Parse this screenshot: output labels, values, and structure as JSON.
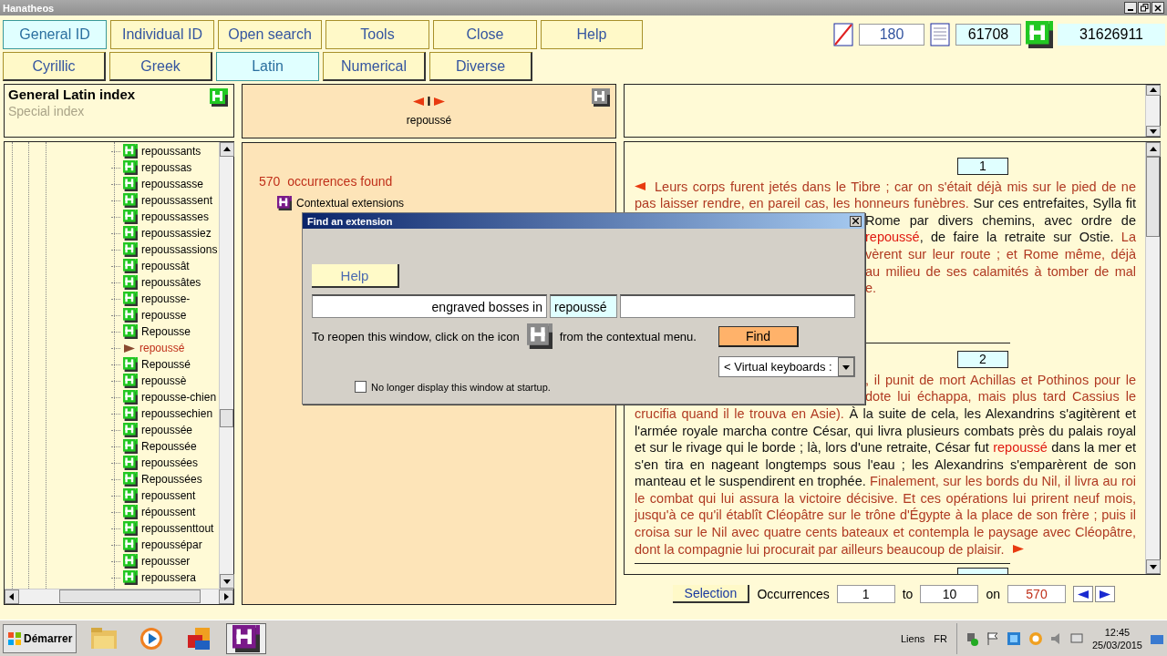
{
  "window": {
    "title": "Hanatheos"
  },
  "nav_buttons": [
    {
      "label": "General ID",
      "selected": true
    },
    {
      "label": "Individual ID",
      "selected": false
    },
    {
      "label": "Open search",
      "selected": false
    },
    {
      "label": "Tools",
      "selected": false
    },
    {
      "label": "Close",
      "selected": false
    },
    {
      "label": "Help",
      "selected": false
    }
  ],
  "alphabet_tabs": [
    {
      "label": "Cyrillic",
      "selected": false
    },
    {
      "label": "Greek",
      "selected": false
    },
    {
      "label": "Latin",
      "selected": true
    },
    {
      "label": "Numerical",
      "selected": false
    },
    {
      "label": "Diverse",
      "selected": false
    }
  ],
  "counters": [
    {
      "kind": "crossed-document",
      "value": "180"
    },
    {
      "kind": "pages",
      "value": "61708"
    },
    {
      "kind": "logo",
      "value": "31626911"
    }
  ],
  "index_panel": {
    "title": "General Latin index",
    "subtitle": "Special index",
    "subtitle_disabled": true
  },
  "index_list": [
    {
      "label": "repoussants",
      "selected": false
    },
    {
      "label": "repoussas",
      "selected": false
    },
    {
      "label": "repoussasse",
      "selected": false
    },
    {
      "label": "repoussassent",
      "selected": false
    },
    {
      "label": "repoussasses",
      "selected": false
    },
    {
      "label": "repoussassiez",
      "selected": false
    },
    {
      "label": "repoussassions",
      "selected": false
    },
    {
      "label": "repoussât",
      "selected": false
    },
    {
      "label": "repoussâtes",
      "selected": false
    },
    {
      "label": "repousse-",
      "selected": false
    },
    {
      "label": "repousse",
      "selected": false
    },
    {
      "label": "Repousse",
      "selected": false
    },
    {
      "label": "repoussé",
      "selected": true
    },
    {
      "label": "Repoussé",
      "selected": false
    },
    {
      "label": "repoussè",
      "selected": false
    },
    {
      "label": "repousse-chien",
      "selected": false
    },
    {
      "label": "repoussechien",
      "selected": false
    },
    {
      "label": "repoussée",
      "selected": false
    },
    {
      "label": "Repoussée",
      "selected": false
    },
    {
      "label": "repoussées",
      "selected": false
    },
    {
      "label": "Repoussées",
      "selected": false
    },
    {
      "label": "repoussent",
      "selected": false
    },
    {
      "label": "répoussent",
      "selected": false
    },
    {
      "label": "repoussenttout",
      "selected": false
    },
    {
      "label": "repoussépar",
      "selected": false
    },
    {
      "label": "repousser",
      "selected": false
    },
    {
      "label": "repoussera",
      "selected": false
    }
  ],
  "word_panel": {
    "separator": "I",
    "word": "repoussé"
  },
  "results": {
    "count": "570",
    "label": "occurrences found",
    "extension_label": "Contextual extensions"
  },
  "passages": [
    {
      "number": "1",
      "start_marker": true,
      "end_marker": false,
      "lines": [
        {
          "covered": false,
          "segments": [
            {
              "kind": "quote",
              "text": "Leurs corps furent jetés dans le Tibre ; car on s'était déjà mis sur le pied de ne"
            }
          ]
        },
        {
          "covered": false,
          "segments": [
            {
              "kind": "quote",
              "text": "pas laisser rendre, en pareil cas, les honneurs funèbres."
            },
            {
              "kind": "plain",
              "text": " Sur ces entrefaites, Sylla fit"
            }
          ]
        },
        {
          "covered": true,
          "segments": [
            {
              "kind": "plain",
              "text": "Rome par divers chemins, avec ordre de"
            }
          ]
        },
        {
          "covered": true,
          "segments": [
            {
              "kind": "match",
              "text": "repoussé"
            },
            {
              "kind": "plain",
              "text": ", de faire la retraite sur Ostie. "
            },
            {
              "kind": "quote",
              "text": "La"
            }
          ]
        },
        {
          "covered": true,
          "segments": [
            {
              "kind": "quote",
              "text": "vèrent sur leur route ; et Rome même, déjà"
            }
          ]
        },
        {
          "covered": true,
          "segments": [
            {
              "kind": "quote",
              "text": "au milieu de ses calamités à tomber de mal"
            }
          ]
        },
        {
          "covered": true,
          "segments": [
            {
              "kind": "quote",
              "text": "e."
            }
          ]
        }
      ]
    },
    {
      "number": "2",
      "start_marker": false,
      "end_marker": true,
      "lines": [
        {
          "covered": true,
          "segments": [
            {
              "kind": "quote",
              "text": ", il punit de mort Achillas et Pothinos pour le"
            }
          ]
        },
        {
          "covered": true,
          "segments": [
            {
              "kind": "quote",
              "text": "dote lui échappa, mais plus tard Cassius le"
            }
          ]
        },
        {
          "covered": false,
          "segments": [
            {
              "kind": "quote",
              "text": "crucifia quand il le trouva en Asie)."
            },
            {
              "kind": "plain",
              "text": " À la suite de cela, les Alexandrins s'agitèrent et"
            }
          ]
        },
        {
          "covered": false,
          "segments": [
            {
              "kind": "plain",
              "text": "l'armée royale marcha contre César, qui livra plusieurs combats près du palais royal"
            }
          ]
        },
        {
          "covered": false,
          "segments": [
            {
              "kind": "plain",
              "text": "et sur le rivage qui le borde ; là, lors d'une retraite, César fut "
            },
            {
              "kind": "match",
              "text": "repoussé"
            },
            {
              "kind": "plain",
              "text": " dans la mer et"
            }
          ]
        },
        {
          "covered": false,
          "segments": [
            {
              "kind": "plain",
              "text": "s'en tira en nageant longtemps sous l'eau ; les Alexandrins s'emparèrent de son"
            }
          ]
        },
        {
          "covered": false,
          "segments": [
            {
              "kind": "plain",
              "text": "manteau et le suspendirent en trophée. "
            },
            {
              "kind": "quote",
              "text": "Finalement, sur les bords du Nil, il livra au roi"
            }
          ]
        },
        {
          "covered": false,
          "segments": [
            {
              "kind": "quote",
              "text": "le combat qui lui assura la victoire décisive. Et ces opérations lui prirent neuf mois,"
            }
          ]
        },
        {
          "covered": false,
          "segments": [
            {
              "kind": "quote",
              "text": "jusqu'à ce qu'il établît Cléopâtre sur le trône d'Égypte à la place de son frère ; puis il"
            }
          ]
        },
        {
          "covered": false,
          "segments": [
            {
              "kind": "quote",
              "text": "croisa sur le Nil avec quatre cents bateaux et contempla le paysage avec Cléopâtre,"
            }
          ]
        },
        {
          "covered": false,
          "segments": [
            {
              "kind": "quote",
              "text": "dont la compagnie lui procurait par ailleurs beaucoup de plaisir."
            }
          ]
        }
      ]
    }
  ],
  "pagination": {
    "selection": "Selection",
    "occurrences_label": "Occurrences",
    "from": "1",
    "to_label": "to",
    "to": "10",
    "on_label": "on",
    "total": "570"
  },
  "dialog": {
    "title": "Find an extension",
    "help": "Help",
    "before": "engraved bosses in",
    "word": "repoussé",
    "hint_before": "To reopen this window, click on the icon",
    "hint_after": "from the contextual menu.",
    "find": "Find",
    "keyboards": "< Virtual keyboards :",
    "startup_label": "No longer display this window at startup.",
    "startup_checked": false
  },
  "taskbar": {
    "start": "Démarrer",
    "links": "Liens",
    "language": "FR",
    "time": "12:45",
    "date": "25/03/2015"
  }
}
